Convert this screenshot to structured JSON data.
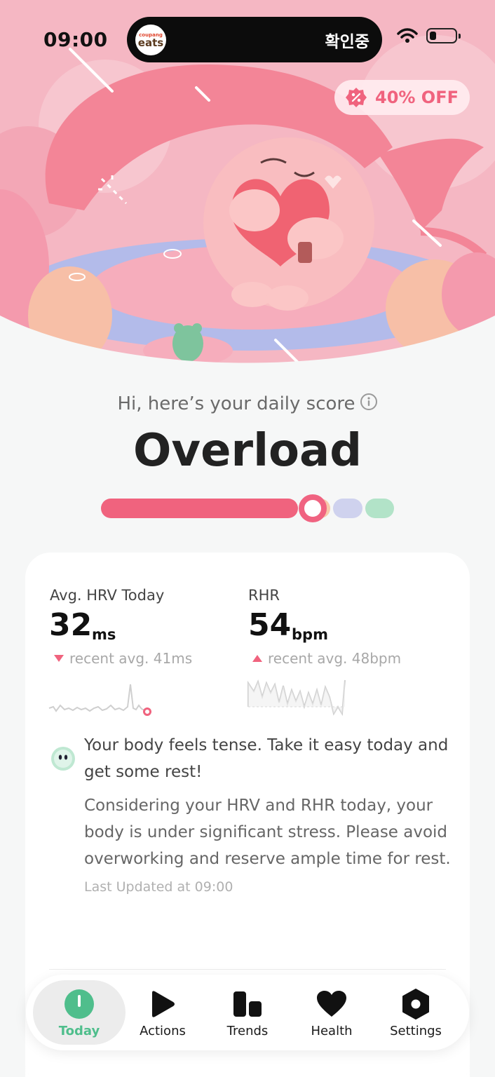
{
  "status_bar": {
    "time": "09:00",
    "island_text": "확인중",
    "app_logo_top": "coupang",
    "app_logo_bottom": "eats",
    "battery_level": 0.25
  },
  "promo": {
    "label": "40% OFF",
    "icon": "discount-badge-icon"
  },
  "score": {
    "greeting": "Hi, here’s your daily score",
    "title": "Overload",
    "scale_colors": [
      "#f0637e",
      "#f7c9a9",
      "#cfd2ee",
      "#b2e3c8"
    ],
    "level_fraction": 0.72
  },
  "metrics": {
    "hrv": {
      "label": "Avg. HRV Today",
      "value": "32",
      "unit": "ms",
      "avg": "recent avg. 41ms",
      "trend": "down",
      "trend_color": "#f0637e"
    },
    "rhr": {
      "label": "RHR",
      "value": "54",
      "unit": "bpm",
      "avg": "recent avg. 48bpm",
      "trend": "up",
      "trend_color": "#f0637e"
    }
  },
  "advice": {
    "headline": "Your body feels tense. Take it easy today and get some rest!",
    "body": "Considering your HRV and RHR today, your body is under significant stress. Please avoid overworking and reserve ample time for rest.",
    "updated": "Last Updated at 09:00"
  },
  "tabs": [
    {
      "label": "Today",
      "icon": "today-icon",
      "active": true
    },
    {
      "label": "Actions",
      "icon": "play-icon",
      "active": false
    },
    {
      "label": "Trends",
      "icon": "bar-chart-icon",
      "active": false
    },
    {
      "label": "Health",
      "icon": "heart-icon",
      "active": false
    },
    {
      "label": "Settings",
      "icon": "gear-icon",
      "active": false
    }
  ],
  "colors": {
    "accent": "#f0637e",
    "active_tab": "#4fbe8c",
    "hero_bg": "#f6b6c2"
  }
}
